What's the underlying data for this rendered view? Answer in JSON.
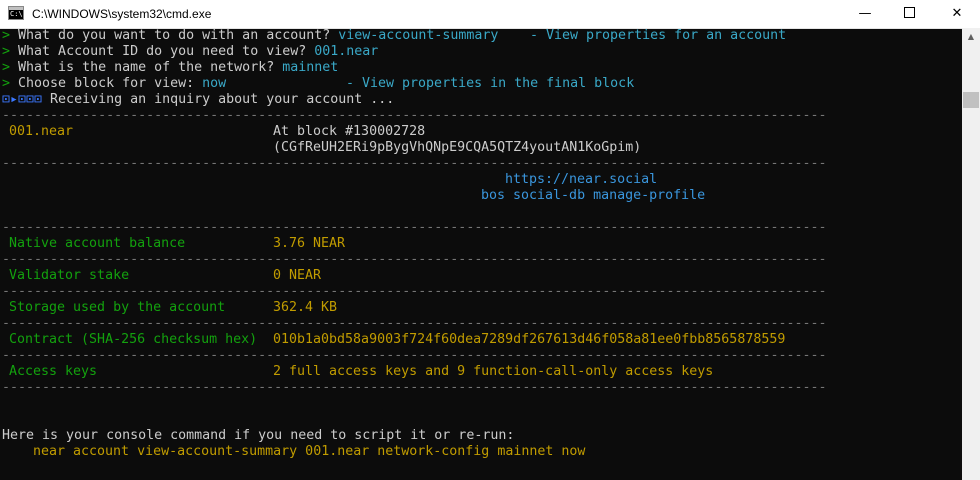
{
  "window": {
    "title": "C:\\WINDOWS\\system32\\cmd.exe",
    "icon_glyph": "C:\\",
    "controls": {
      "minimize": "—",
      "close": "✕"
    }
  },
  "prompts": [
    {
      "marker": ">",
      "question": "What do you want to do with an account?",
      "answer": "view-account-summary",
      "hint": "- View properties for an account"
    },
    {
      "marker": ">",
      "question": "What Account ID do you need to view?",
      "answer": "001.near",
      "hint": ""
    },
    {
      "marker": ">",
      "question": "What is the name of the network?",
      "answer": "mainnet",
      "hint": ""
    },
    {
      "marker": ">",
      "question": "Choose block for view:",
      "answer": "now",
      "hint": "- View properties in the final block"
    }
  ],
  "status": {
    "spinner": "⊡▸⊡⊡⊡",
    "text": "Receiving an inquiry about your account ..."
  },
  "separator": "-------------------------------------------------------------------------------------------------------",
  "account": {
    "id": "001.near",
    "block_label": "At block #130002728",
    "block_hash": "(CGfReUH2ERi9pBygVhQNpE9CQA5QTZ4youtAN1KoGpim)"
  },
  "profile": {
    "link": "https://near.social",
    "command": "bos social-db manage-profile"
  },
  "properties": [
    {
      "label": "Native account balance",
      "value": "3.76 NEAR"
    },
    {
      "label": "Validator stake",
      "value": "0 NEAR"
    },
    {
      "label": "Storage used by the account",
      "value": "362.4 KB"
    },
    {
      "label": "Contract (SHA-256 checksum hex)",
      "value": "010b1a0bd58a9003f724f60dea7289df267613d46f058a81ee0fbb8565878559"
    },
    {
      "label": "Access keys",
      "value": "2 full access keys and 9 function-call-only access keys"
    }
  ],
  "footer": {
    "intro": "Here is your console command if you need to script it or re-run:",
    "command": "near account view-account-summary 001.near network-config mainnet now"
  },
  "scrollbar": {
    "up_arrow": "▲"
  }
}
